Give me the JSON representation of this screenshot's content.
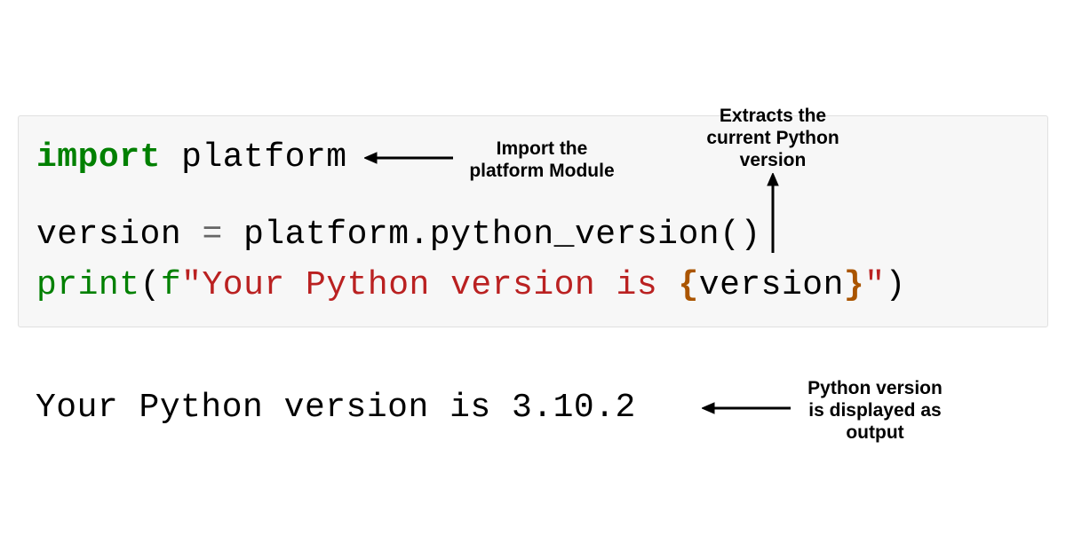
{
  "code": {
    "line1": {
      "import": "import",
      "module": "platform"
    },
    "line2": {
      "var": "version",
      "eq": "=",
      "call": "platform.python_version()"
    },
    "line3": {
      "print": "print",
      "f": "f",
      "str1": "\"Your Python version is ",
      "brace_open": "{",
      "var": "version",
      "brace_close": "}",
      "str2": "\""
    }
  },
  "output": {
    "text": "Your Python version is 3.10.2"
  },
  "annotations": {
    "a1": "Import the\nplatform Module",
    "a2": "Extracts the\ncurrent Python\nversion",
    "a3": "Python version\nis displayed as\noutput"
  }
}
